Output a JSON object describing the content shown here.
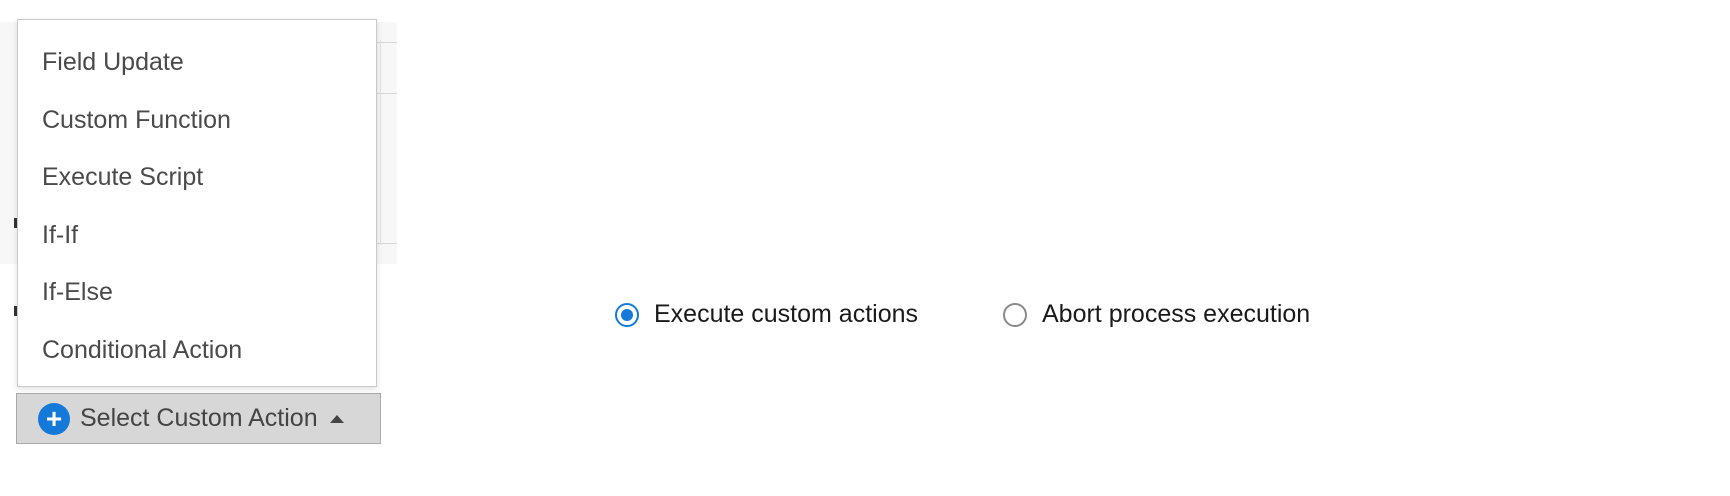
{
  "dropdown": {
    "items": [
      {
        "label": "Field Update"
      },
      {
        "label": "Custom Function"
      },
      {
        "label": "Execute Script"
      },
      {
        "label": "If-If"
      },
      {
        "label": "If-Else"
      },
      {
        "label": "Conditional Action"
      }
    ]
  },
  "select_button": {
    "label": "Select Custom Action",
    "icon": "plus-icon",
    "caret_icon": "caret-up-icon"
  },
  "radio_group": {
    "options": [
      {
        "label": "Execute custom actions",
        "checked": true
      },
      {
        "label": "Abort process execution",
        "checked": false
      }
    ]
  },
  "colors": {
    "accent": "#1479d8",
    "button_bg": "#d7d7d7",
    "menu_text": "#4a4a4a"
  }
}
